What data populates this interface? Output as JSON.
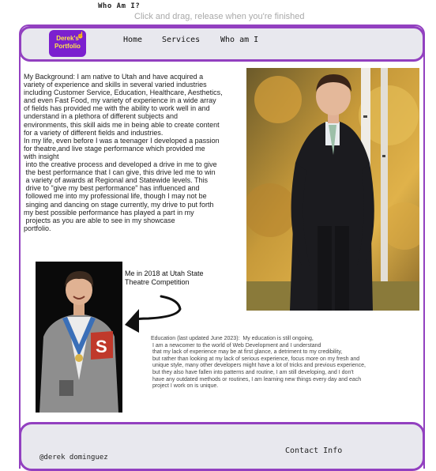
{
  "page": {
    "top_title": "Who Am I?",
    "hint": "Click and drag, release when you're finished"
  },
  "header": {
    "logo_text": "Derek's Portfolio",
    "nav": [
      "Home",
      "Services",
      "Who am I"
    ]
  },
  "main": {
    "bio": "My Background: I am native to Utah and have acquired a\nvariety of experience and skills in several varied industries\nincluding Customer Service, Education, Healthcare, Aesthetics,\nand even Fast Food, my variety of experience in a wide array\nof fields has provided me with the ability to work well in and\nunderstand in a plethora of different subjects and\nenvironments, this skill aids me in being able to create content\nfor a variety of different fields and industries.\nIn my life, even before I was a teenager I developed a passion\nfor theatre,and live stage performance which provided me\nwith insight\n into the creative process and developed a drive in me to give\n the best performance that I can give, this drive led me to win\n a variety of awards at Regional and Statewide levels. This\n drive to \"give my best performance\" has influenced and\n followed me into my professional life, though I may not be\n singing and dancing on stage currently, my drive to put forth\nmy best possible performance has played a part in my\n projects as you are able to see in my showcase\nportfolio.",
    "photo_caption": "Me in 2018 at Utah State\nTheatre Competition",
    "education": "Education (last updated June 2023):  My education is still ongoing,\n I am a newcomer to the world of Web Development and I understand\n that my lack of experience may be at first glance, a detriment to my credibility,\n but rather than looking at my lack of serious experience, focus more on my fresh and\n unique style, many other developers might have a lot of tricks and previous experience,\n but they also have fallen into patterns and routine, I am still developing, and I don't\n have any outdated methods or routines, I am learning new things every day and each\n project I work on is unique."
  },
  "footer": {
    "handle": "@derek dominguez",
    "contact": "Contact Info"
  },
  "colors": {
    "accent": "#9240c0",
    "logo_bg": "#7b1fcf",
    "logo_text": "#ffe44a",
    "header_bg": "#e8e8ee"
  }
}
